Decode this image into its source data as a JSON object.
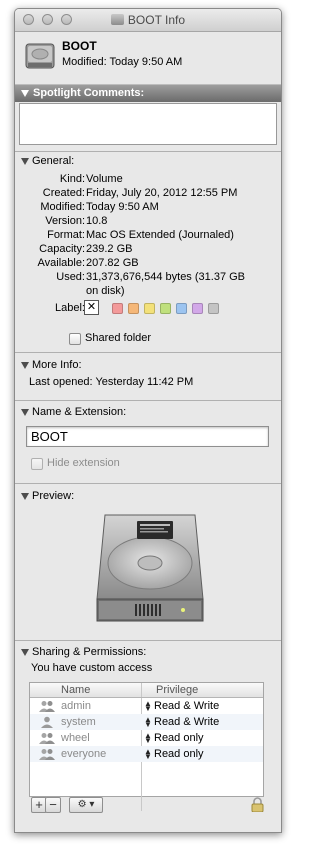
{
  "window": {
    "title": "BOOT Info"
  },
  "header": {
    "name": "BOOT",
    "modified": "Modified: Today 9:50 AM"
  },
  "spotlight": {
    "label": "Spotlight Comments:"
  },
  "general": {
    "label": "General:",
    "rows": [
      {
        "k": "Kind:",
        "v": "Volume"
      },
      {
        "k": "Created:",
        "v": "Friday, July 20, 2012 12:55 PM"
      },
      {
        "k": "Modified:",
        "v": "Today 9:50 AM"
      },
      {
        "k": "Version:",
        "v": "10.8"
      },
      {
        "k": "Format:",
        "v": "Mac OS Extended (Journaled)"
      },
      {
        "k": "Capacity:",
        "v": "239.2 GB"
      },
      {
        "k": "Available:",
        "v": "207.82 GB"
      },
      {
        "k": "Used:",
        "v": "31,373,676,544 bytes (31.37 GB"
      },
      {
        "k": "",
        "v": "on disk)"
      }
    ],
    "label_field": "Label:",
    "label_colors": [
      "#f39a9a",
      "#f5b778",
      "#f3e17a",
      "#bfe07d",
      "#9cc4f0",
      "#d2a8e8",
      "#c4c4c4"
    ],
    "shared_folder": "Shared folder"
  },
  "more_info": {
    "label": "More Info:",
    "last_opened": "Last opened: Yesterday 11:42 PM"
  },
  "name_ext": {
    "label": "Name & Extension:",
    "value": "BOOT",
    "hide_extension": "Hide extension"
  },
  "preview": {
    "label": "Preview:"
  },
  "sharing": {
    "label": "Sharing & Permissions:",
    "access": "You have custom access",
    "col_name": "Name",
    "col_priv": "Privilege",
    "rows": [
      {
        "name": "admin",
        "priv": "Read & Write",
        "icon": "group-icon"
      },
      {
        "name": "system",
        "priv": "Read & Write",
        "icon": "user-icon"
      },
      {
        "name": "wheel",
        "priv": "Read only",
        "icon": "group-icon"
      },
      {
        "name": "everyone",
        "priv": "Read only",
        "icon": "group-icon"
      }
    ],
    "add": "+",
    "remove": "−",
    "action": "⚙ ▾"
  }
}
